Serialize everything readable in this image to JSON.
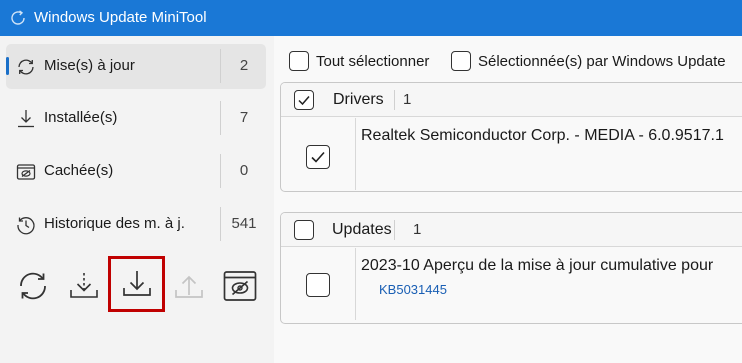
{
  "window": {
    "title": "Windows Update MiniTool"
  },
  "sidebar": {
    "items": [
      {
        "label": "Mise(s) à jour",
        "count": "2",
        "icon": "refresh-icon"
      },
      {
        "label": "Installée(s)",
        "count": "7",
        "icon": "download-icon"
      },
      {
        "label": "Cachée(s)",
        "count": "0",
        "icon": "hidden-icon"
      },
      {
        "label": "Historique des m. à j.",
        "count": "541",
        "icon": "history-icon"
      }
    ],
    "actions": [
      "refresh-icon",
      "check-download-icon",
      "download-install-icon",
      "upload-icon",
      "hide-update-icon"
    ]
  },
  "toolbar": {
    "select_all": "Tout sélectionner",
    "selected_by_wu": "Sélectionnée(s) par Windows Update"
  },
  "groups": [
    {
      "name": "Drivers",
      "count": "1",
      "checked": true,
      "items": [
        {
          "title": "Realtek Semiconductor Corp. - MEDIA - 6.0.9517.1",
          "kb": "",
          "checked": true
        }
      ]
    },
    {
      "name": "Updates",
      "count": "1",
      "checked": false,
      "items": [
        {
          "title": "2023-10 Aperçu de la mise à jour cumulative pour",
          "kb": "KB5031445",
          "checked": false
        }
      ]
    }
  ],
  "colors": {
    "titlebar": "#1a78d6",
    "accent": "#1a6fc8",
    "highlight": "#c00000"
  }
}
